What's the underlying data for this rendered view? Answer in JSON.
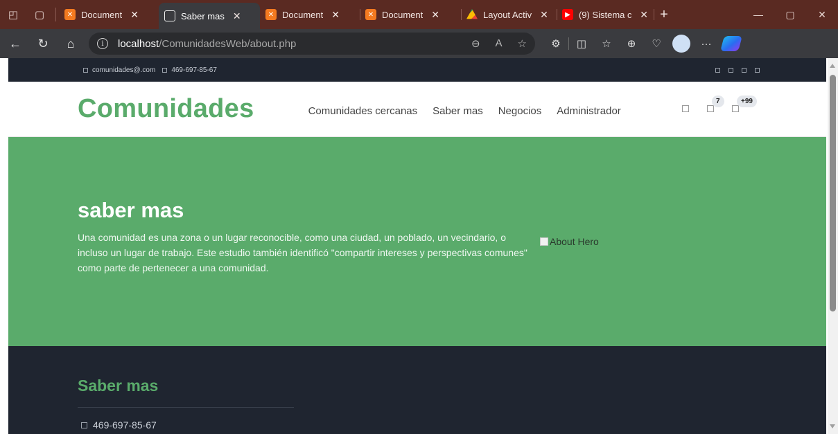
{
  "browser": {
    "tabs": [
      {
        "label": "Document",
        "favicon": "xampp-icon",
        "active": false
      },
      {
        "label": "Saber mas",
        "favicon": "page-icon",
        "active": true
      },
      {
        "label": "Document",
        "favicon": "xampp-icon",
        "active": false
      },
      {
        "label": "Document",
        "favicon": "xampp-icon",
        "active": false
      },
      {
        "label": "Layout Activ",
        "favicon": "drive-icon",
        "active": false
      },
      {
        "label": "(9) Sistema c",
        "favicon": "youtube-icon",
        "active": false
      }
    ],
    "url_host": "localhost",
    "url_path": "/ComunidadesWeb/about.php"
  },
  "topbar": {
    "email": "comunidades@.com",
    "phone": "469-697-85-67"
  },
  "header": {
    "brand": "Comunidades",
    "menu": [
      "Comunidades cercanas",
      "Saber mas",
      "Negocios",
      "Administrador"
    ],
    "badge_1": "7",
    "badge_2": "+99"
  },
  "hero": {
    "title": "saber mas",
    "text": "Una comunidad es una zona o un lugar reconocible, como una ciudad, un poblado, un vecindario, o incluso un lugar de trabajo. Este estudio también identificó \"compartir intereses y perspectivas comunes\" como parte de pertenecer a una comunidad.",
    "image_alt": "About Hero"
  },
  "footer": {
    "title": "Saber mas",
    "phone": "469-697-85-67"
  },
  "colors": {
    "brand_green": "#5aab6b",
    "dark_navy": "#1f2530",
    "browser_frame": "#5a2a22"
  }
}
